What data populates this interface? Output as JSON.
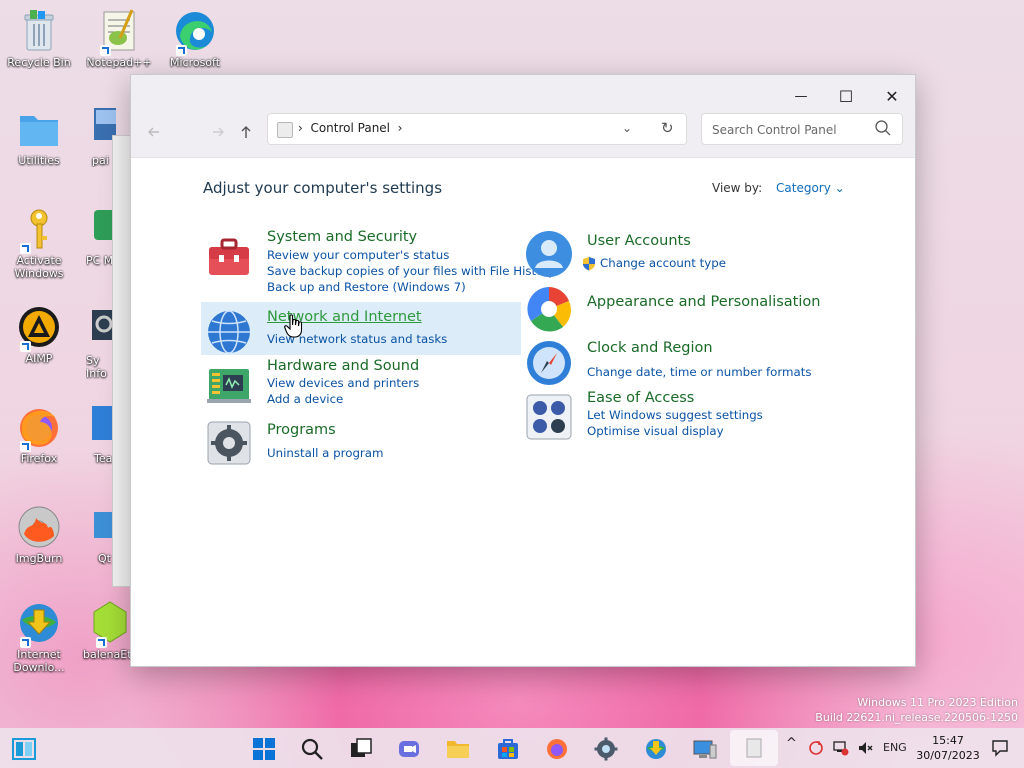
{
  "desktop": {
    "icons": [
      {
        "label": "Recycle Bin"
      },
      {
        "label": "Notepad++"
      },
      {
        "label": "Microsoft"
      },
      {
        "label": "Utilities"
      },
      {
        "label": "pai"
      },
      {
        "label": "Activate Windows"
      },
      {
        "label": "PC M"
      },
      {
        "label": "AIMP"
      },
      {
        "label": "Sy Info"
      },
      {
        "label": "Firefox"
      },
      {
        "label": "Tea"
      },
      {
        "label": "ImgBurn"
      },
      {
        "label": "Qt"
      },
      {
        "label": "Internet Downlo..."
      },
      {
        "label": "balenaEt"
      }
    ]
  },
  "window": {
    "controls": {
      "minimize": "—",
      "maximize": "☐",
      "close": "✕"
    },
    "address": {
      "separator": "›",
      "crumb": "Control Panel",
      "trail": "›",
      "dropdown": "⌄",
      "refresh": "↻"
    },
    "search_placeholder": "Search Control Panel",
    "heading": "Adjust your computer's settings",
    "view_by_label": "View by:",
    "view_by_value": "Category ⌄",
    "categories": [
      {
        "title": "System and Security",
        "links": [
          "Review your computer's status",
          "Save backup copies of your files with File History",
          "Back up and Restore (Windows 7)"
        ]
      },
      {
        "title": "Network and Internet",
        "links": [
          "View network status and tasks"
        ]
      },
      {
        "title": "Hardware and Sound",
        "links": [
          "View devices and printers",
          "Add a device"
        ]
      },
      {
        "title": "Programs",
        "links": [
          "Uninstall a program"
        ]
      },
      {
        "title": "User Accounts",
        "links": [
          "Change account type"
        ]
      },
      {
        "title": "Appearance and Personalisation",
        "links": []
      },
      {
        "title": "Clock and Region",
        "links": [
          "Change date, time or number formats"
        ]
      },
      {
        "title": "Ease of Access",
        "links": [
          "Let Windows suggest settings",
          "Optimise visual display"
        ]
      }
    ]
  },
  "watermark": {
    "line1": "Windows 11 Pro 2023 Edition",
    "line2": "Build 22621.ni_release.220506-1250"
  },
  "taskbar": {
    "language": "ENG",
    "time": "15:47",
    "date": "30/07/2023"
  },
  "colors": {
    "accent": "#0f6cbd",
    "category_title": "#1a6a28",
    "link": "#0b53a5",
    "highlight": "#dcecf8"
  }
}
